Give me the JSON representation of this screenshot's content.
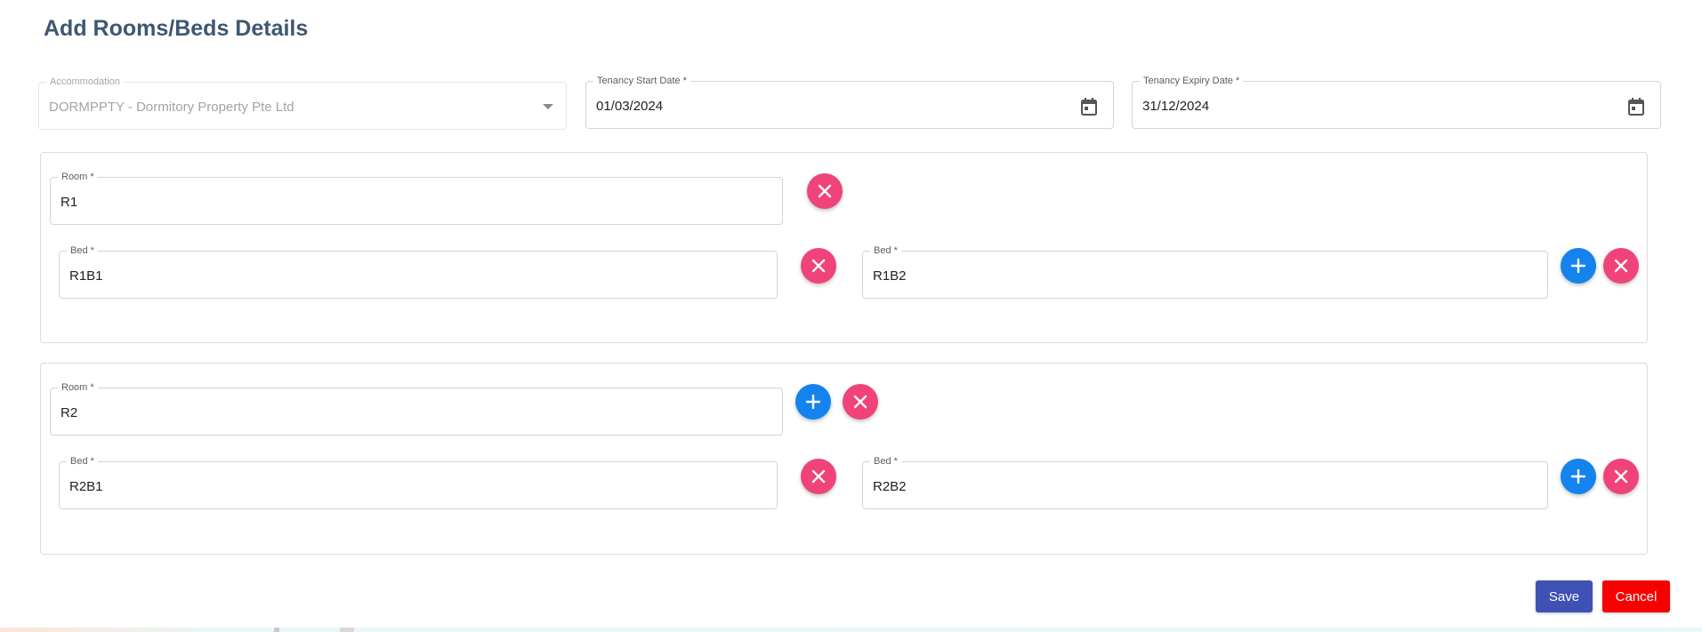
{
  "page": {
    "title": "Add Rooms/Beds Details"
  },
  "header_fields": {
    "accommodation": {
      "label": "Accommodation",
      "value": "DORMPPTY - Dormitory Property Pte Ltd"
    },
    "start_date": {
      "label": "Tenancy Start Date *",
      "value": "01/03/2024"
    },
    "expiry_date": {
      "label": "Tenancy Expiry Date *",
      "value": "31/12/2024"
    }
  },
  "rooms": [
    {
      "room_label": "Room *",
      "room_value": "R1",
      "beds": [
        {
          "label": "Bed *",
          "value": "R1B1"
        },
        {
          "label": "Bed *",
          "value": "R1B2"
        }
      ]
    },
    {
      "room_label": "Room *",
      "room_value": "R2",
      "beds": [
        {
          "label": "Bed *",
          "value": "R2B1"
        },
        {
          "label": "Bed *",
          "value": "R2B2"
        }
      ]
    }
  ],
  "actions": {
    "save_label": "Save",
    "cancel_label": "Cancel"
  },
  "colors": {
    "title": "#3d5872",
    "remove": "#f0437a",
    "add": "#1483ee",
    "save": "#3f51b5",
    "cancel": "#f70000"
  },
  "icons": {
    "remove": "close-icon",
    "add": "plus-icon",
    "date": "calendar-icon",
    "dropdown": "caret-down-icon"
  }
}
